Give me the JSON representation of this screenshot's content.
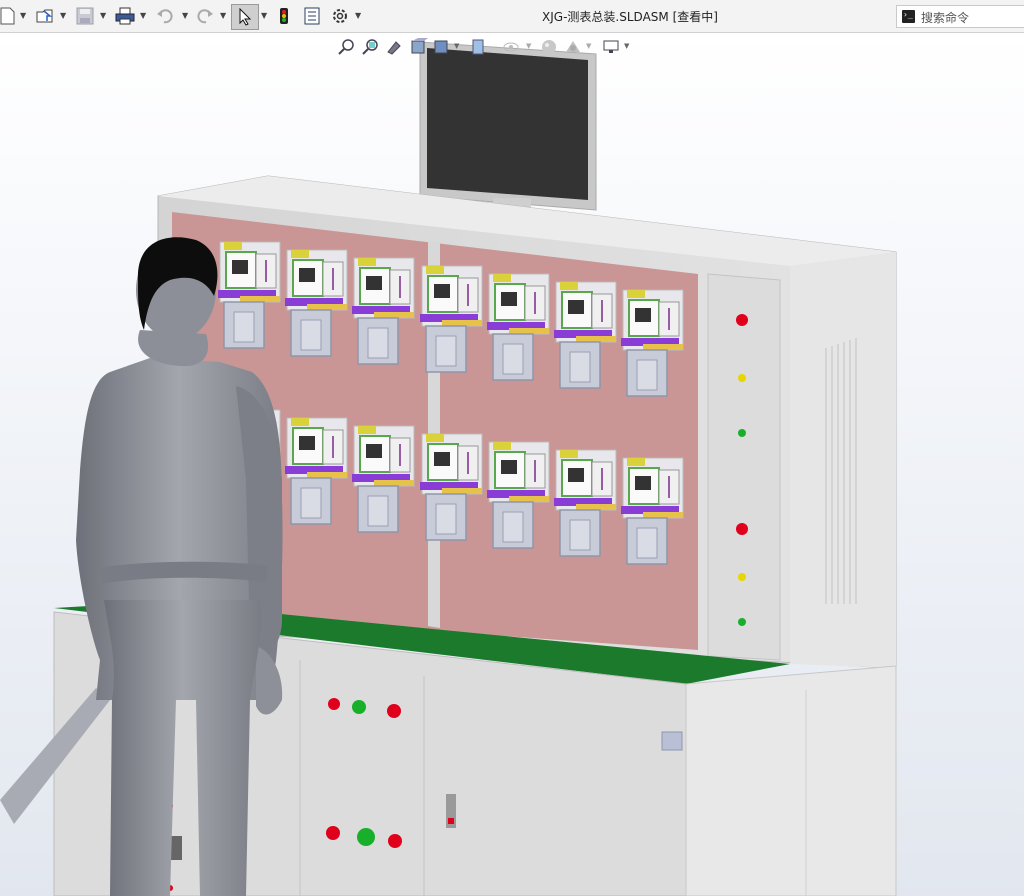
{
  "toolbar": {
    "items": [
      {
        "name": "new-document-icon"
      },
      {
        "name": "open-folder-icon"
      },
      {
        "name": "save-icon"
      },
      {
        "name": "print-icon"
      },
      {
        "name": "undo-icon"
      },
      {
        "name": "redo-icon"
      },
      {
        "name": "select-cursor-icon"
      },
      {
        "name": "traffic-light-icon"
      },
      {
        "name": "file-properties-icon"
      },
      {
        "name": "gear-icon"
      }
    ]
  },
  "document": {
    "title": "XJG-测表总装.SLDASM [查看中]"
  },
  "search": {
    "placeholder": "搜索命令"
  },
  "hud_icons": [
    "zoom-to-fit-icon",
    "zoom-area-icon",
    "previous-view-icon",
    "section-view-icon",
    "view-orientation-icon",
    "display-style-icon",
    "hide-show-icon",
    "edit-appearance-icon",
    "apply-scene-icon",
    "view-settings-icon"
  ],
  "colors": {
    "toolbar_bg": "#f3f3f3",
    "panel_pink": "#c99695",
    "cabinet_gray": "#dadada",
    "desk_green": "#1c7a2c",
    "lamp_red": "#e0001b",
    "lamp_yellow": "#e8d600",
    "lamp_green": "#18b02a"
  }
}
